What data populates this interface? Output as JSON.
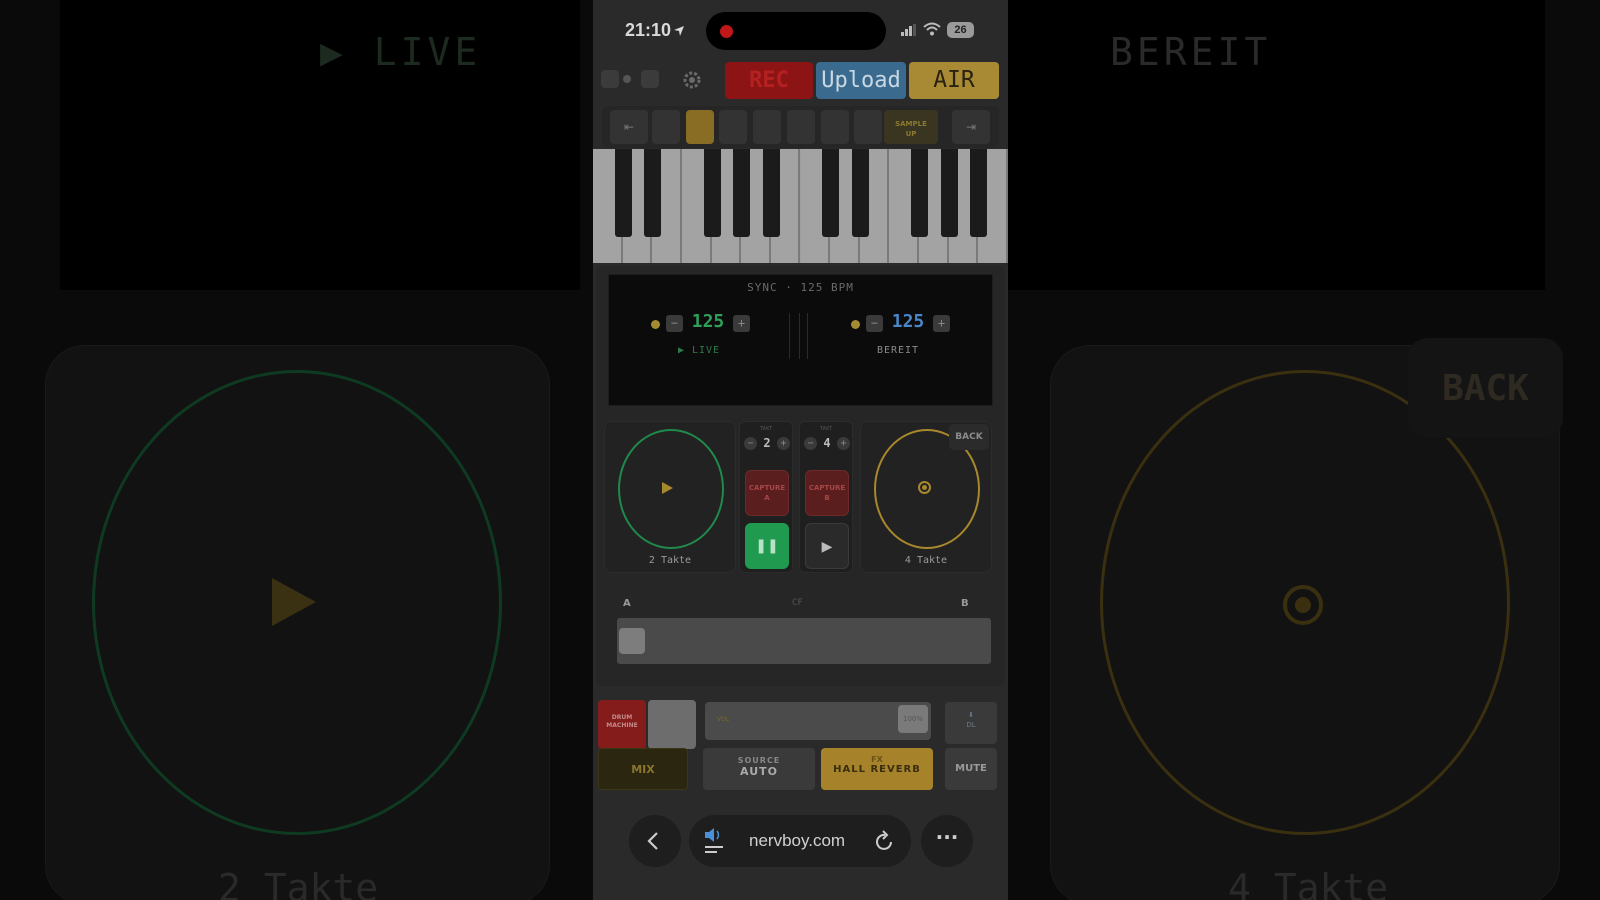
{
  "background": {
    "live_text": "▶ LIVE",
    "bereit_text": "BEREIT",
    "back_text": "BACK",
    "left_deck_label": "2 Takte",
    "right_deck_label": "4 Takte"
  },
  "status_bar": {
    "time": "21:10",
    "battery": "26"
  },
  "actionbar": {
    "rec_label": "REC",
    "upload_label": "Upload",
    "air_label": "AIR"
  },
  "toolbar": {
    "sample_label": "SAMPLE",
    "sample_sub": "UP",
    "tools": [
      "left-nav",
      "piano",
      "pencil-A",
      "balloon",
      "screen",
      "palm",
      "joystick",
      "pads",
      "sample",
      "right-nav"
    ]
  },
  "display": {
    "sync_text": "SYNC · 125 BPM",
    "deck_a": {
      "bpm": "125",
      "status": "▶ LIVE"
    },
    "deck_b": {
      "bpm": "125",
      "status": "BEREIT"
    }
  },
  "decks": {
    "a": {
      "label": "2 Takte",
      "takt": "2",
      "capture_label": "CAPTURE",
      "capture_sub": "A"
    },
    "b": {
      "label": "4 Takte",
      "takt": "4",
      "capture_label": "CAPTURE",
      "capture_sub": "B",
      "back_label": "BACK"
    },
    "takt_caption": "TAKT"
  },
  "crossfader": {
    "label_a": "A",
    "label_cf": "CF",
    "label_b": "B",
    "position": 0.0
  },
  "bottom": {
    "drum_label": "DRUM MACHINE",
    "fader_value": "100%",
    "dl_label": "DL",
    "mix_label": "MIX",
    "source_title": "SOURCE",
    "source_value": "AUTO",
    "fx_title": "FX",
    "fx_value": "HALL REVERB",
    "mute_label": "MUTE"
  },
  "browser": {
    "url": "nervboy.com"
  },
  "colors": {
    "deck_a_accent": "#1f8a4c",
    "deck_b_accent": "#a8882c",
    "rec": "#8d1414",
    "upload": "#3a6b8f",
    "air": "#a88a35",
    "bpm_a": "#2ea05a",
    "bpm_b": "#4a86c8"
  }
}
